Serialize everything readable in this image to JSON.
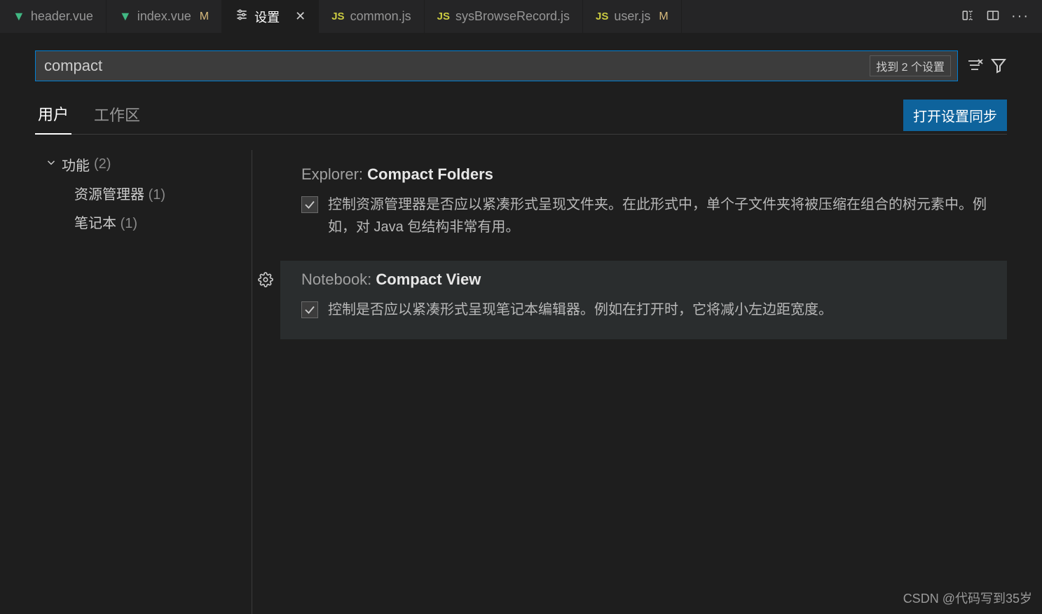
{
  "tabs": [
    {
      "icon": "vue",
      "label": "header.vue",
      "mod": ""
    },
    {
      "icon": "vue",
      "label": "index.vue",
      "mod": "M"
    },
    {
      "icon": "settings",
      "label": "设置",
      "active": true,
      "close": true
    },
    {
      "icon": "js",
      "label": "common.js"
    },
    {
      "icon": "js",
      "label": "sysBrowseRecord.js"
    },
    {
      "icon": "js",
      "label": "user.js",
      "mod": "M"
    }
  ],
  "search": {
    "value": "compact",
    "count_label": "找到 2 个设置"
  },
  "scopes": {
    "user": "用户",
    "workspace": "工作区"
  },
  "sync_button": "打开设置同步",
  "sidebar": {
    "group": {
      "label": "功能",
      "count": "(2)"
    },
    "items": [
      {
        "label": "资源管理器",
        "count": "(1)"
      },
      {
        "label": "笔记本",
        "count": "(1)"
      }
    ]
  },
  "settings": [
    {
      "scope": "Explorer:",
      "name": "Compact Folders",
      "checked": true,
      "desc": "控制资源管理器是否应以紧凑形式呈现文件夹。在此形式中，单个子文件夹将被压缩在组合的树元素中。例如，对 Java 包结构非常有用。"
    },
    {
      "scope": "Notebook:",
      "name": "Compact View",
      "checked": true,
      "hover": true,
      "gear": true,
      "desc": "控制是否应以紧凑形式呈现笔记本编辑器。例如在打开时，它将减小左边距宽度。"
    }
  ],
  "watermark": "CSDN @代码写到35岁"
}
